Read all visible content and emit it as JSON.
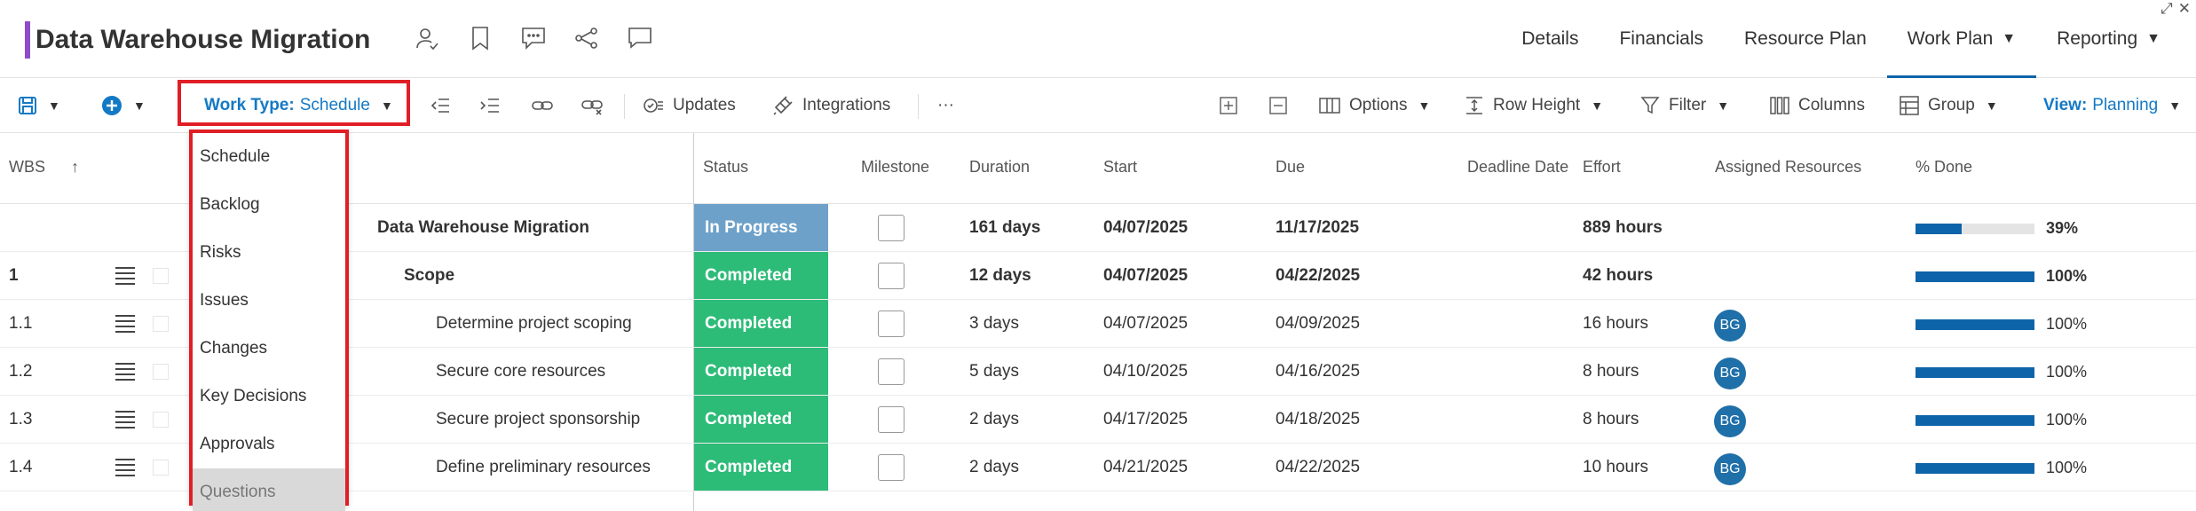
{
  "app": {
    "title": "Data Warehouse Migration",
    "accent_color": "#8e4cc9",
    "header_icons": [
      "assign-user-icon",
      "bookmark-icon",
      "comment-icon",
      "share-icon",
      "chat-icon"
    ],
    "nav": [
      {
        "label": "Details"
      },
      {
        "label": "Financials"
      },
      {
        "label": "Resource Plan"
      },
      {
        "label": "Work Plan",
        "active": true,
        "caret": "▼"
      },
      {
        "label": "Reporting",
        "caret": "▼"
      }
    ],
    "corner_icons": [
      "⤢",
      "✕"
    ]
  },
  "toolbar": {
    "save_icon": "save-icon",
    "add_icon": "add-icon",
    "work_type_label": "Work Type:",
    "work_type_value": "Schedule",
    "updates_label": "Updates",
    "integrations_label": "Integrations",
    "more_label": "···",
    "options_label": "Options",
    "row_height_label": "Row Height",
    "filter_label": "Filter",
    "columns_label": "Columns",
    "group_label": "Group",
    "view_label": "View:",
    "view_value": "Planning",
    "caret": "▼"
  },
  "dropdown": {
    "items": [
      "Schedule",
      "Backlog",
      "Risks",
      "Issues",
      "Changes",
      "Key Decisions",
      "Approvals",
      "Questions"
    ],
    "hovered": "Questions"
  },
  "grid": {
    "headers": {
      "wbs": "WBS",
      "sort_icon": "↑",
      "status": "Status",
      "milestone": "Milestone",
      "duration": "Duration",
      "start": "Start",
      "due": "Due",
      "deadline": "Deadline Date",
      "effort": "Effort",
      "resources": "Assigned Resources",
      "done": "% Done"
    },
    "rows": [
      {
        "wbs": "",
        "name": "Data Warehouse Migration",
        "status": "In Progress",
        "duration": "161 days",
        "start": "04/07/2025",
        "due": "11/17/2025",
        "effort": "889 hours",
        "resource": "",
        "percent": 39,
        "percent_label": "39%",
        "summary": true,
        "indent": 0
      },
      {
        "wbs": "1",
        "name": "Scope",
        "status": "Completed",
        "duration": "12 days",
        "start": "04/07/2025",
        "due": "04/22/2025",
        "effort": "42 hours",
        "resource": "",
        "percent": 100,
        "percent_label": "100%",
        "summary": true,
        "indent": 1
      },
      {
        "wbs": "1.1",
        "name": "Determine project scoping",
        "status": "Completed",
        "duration": "3 days",
        "start": "04/07/2025",
        "due": "04/09/2025",
        "effort": "16 hours",
        "resource": "BG",
        "percent": 100,
        "percent_label": "100%",
        "summary": false,
        "indent": 2
      },
      {
        "wbs": "1.2",
        "name": "Secure core resources",
        "status": "Completed",
        "duration": "5 days",
        "start": "04/10/2025",
        "due": "04/16/2025",
        "effort": "8 hours",
        "resource": "BG",
        "percent": 100,
        "percent_label": "100%",
        "summary": false,
        "indent": 2
      },
      {
        "wbs": "1.3",
        "name": "Secure project sponsorship",
        "status": "Completed",
        "duration": "2 days",
        "start": "04/17/2025",
        "due": "04/18/2025",
        "effort": "8 hours",
        "resource": "BG",
        "percent": 100,
        "percent_label": "100%",
        "summary": false,
        "indent": 2
      },
      {
        "wbs": "1.4",
        "name": "Define preliminary resources",
        "status": "Completed",
        "duration": "2 days",
        "start": "04/21/2025",
        "due": "04/22/2025",
        "effort": "10 hours",
        "resource": "BG",
        "percent": 100,
        "percent_label": "100%",
        "summary": false,
        "indent": 2
      }
    ],
    "status_colors": {
      "In Progress": "#6ea1c9",
      "Completed": "#2dbb78"
    },
    "progress_color": "#0e64a8"
  }
}
